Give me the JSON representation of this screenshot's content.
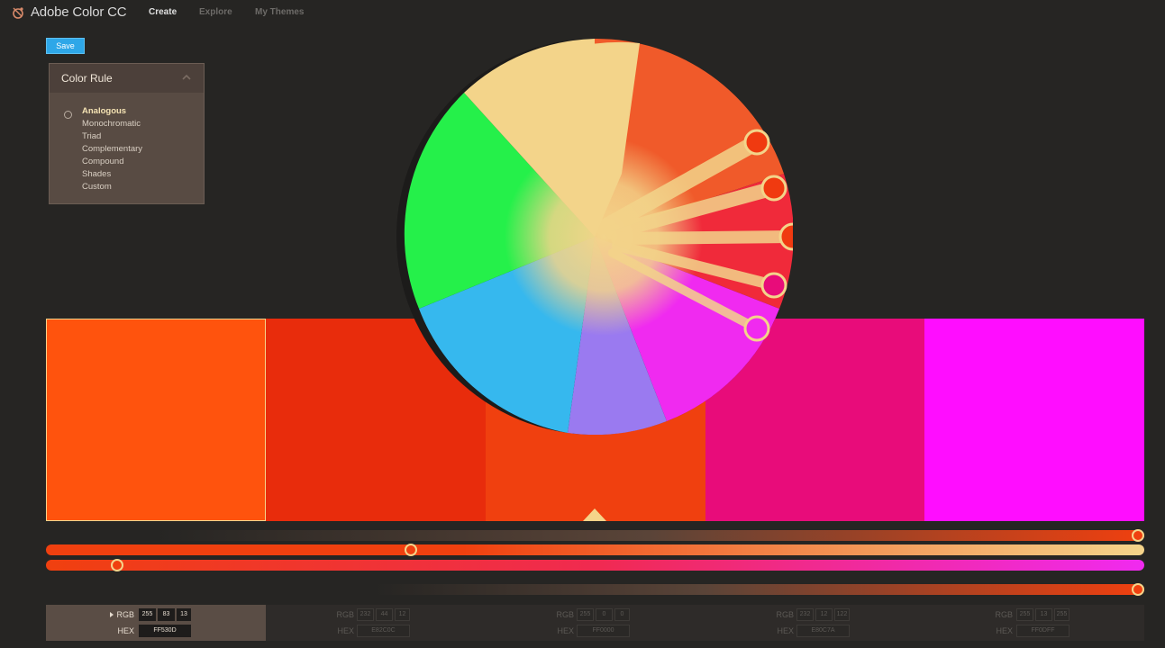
{
  "app": {
    "title": "Adobe Color CC"
  },
  "nav": {
    "items": [
      "Create",
      "Explore",
      "My Themes"
    ]
  },
  "toolbar": {
    "save_label": "Save"
  },
  "color_rule": {
    "title": "Color Rule",
    "options": [
      "Analogous",
      "Monochromatic",
      "Triad",
      "Complementary",
      "Compound",
      "Shades",
      "Custom"
    ],
    "selected": "Analogous"
  },
  "swatches": [
    {
      "color": "#FF530D",
      "rgb": [
        "255",
        "83",
        "13"
      ],
      "hex": "FF530D"
    },
    {
      "color": "#E82C0C",
      "rgb": [
        "232",
        "44",
        "12"
      ],
      "hex": "E82C0C"
    },
    {
      "color": "#FF0000",
      "rgb": [
        "255",
        "0",
        "0"
      ],
      "hex": "FF0000"
    },
    {
      "color": "#E80C7A",
      "rgb": [
        "232",
        "12",
        "122"
      ],
      "hex": "E80C7A"
    },
    {
      "color": "#FF0DFF",
      "rgb": [
        "255",
        "13",
        "255"
      ],
      "hex": "FF0DFF"
    }
  ],
  "labels": {
    "rgb": "RGB",
    "hex": "HEX"
  },
  "sliders": {
    "brightness": 1.0,
    "saturation": 0.33,
    "hue": 0.06,
    "bottom": 1.0
  }
}
